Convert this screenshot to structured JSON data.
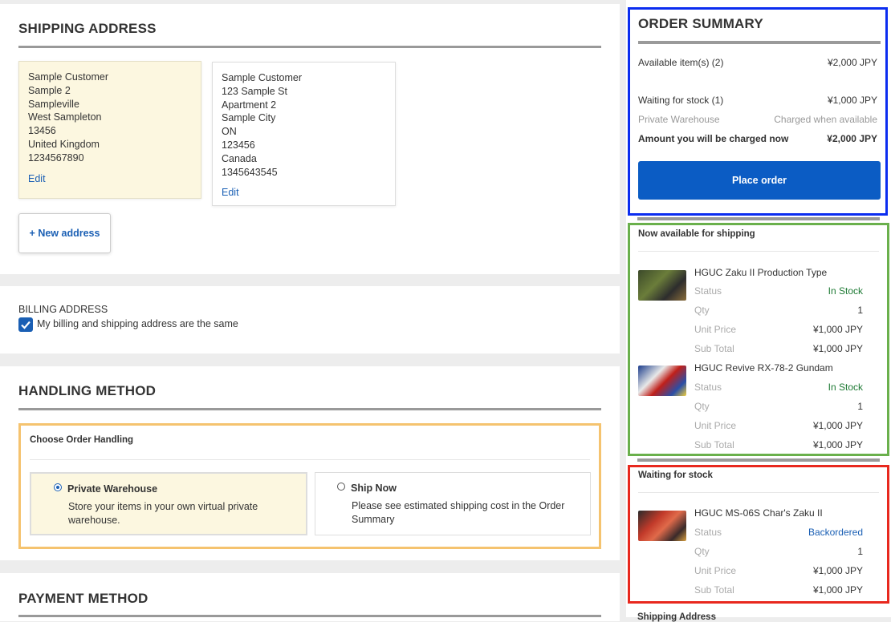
{
  "shipping": {
    "title": "SHIPPING ADDRESS",
    "addresses": [
      {
        "lines": [
          "Sample Customer",
          "Sample 2",
          "Sampleville",
          "West Sampleton",
          "13456",
          "United Kingdom",
          "1234567890"
        ],
        "edit": "Edit",
        "selected": true
      },
      {
        "lines": [
          "Sample Customer",
          "123 Sample St",
          "Apartment 2",
          "Sample City",
          "ON",
          "123456",
          "Canada",
          "1345643545"
        ],
        "edit": "Edit",
        "selected": false
      }
    ],
    "new_address": "+ New address"
  },
  "billing": {
    "title": "BILLING ADDRESS",
    "same_label": "My billing and shipping address are the same",
    "checked": true
  },
  "handling": {
    "title": "HANDLING METHOD",
    "choose_label": "Choose Order Handling",
    "options": [
      {
        "title": "Private Warehouse",
        "desc": "Store your items in your own virtual private warehouse.",
        "selected": true
      },
      {
        "title": "Ship Now",
        "desc": "Please see estimated shipping cost in the Order Summary",
        "selected": false
      }
    ]
  },
  "payment": {
    "title": "PAYMENT METHOD"
  },
  "summary": {
    "title": "ORDER SUMMARY",
    "available_label": "Available item(s) (2)",
    "available_value": "¥2,000 JPY",
    "waiting_label": "Waiting for stock (1)",
    "waiting_value": "¥1,000 JPY",
    "warehouse_label": "Private Warehouse",
    "warehouse_value": "Charged when available",
    "charged_label": "Amount you will be charged now",
    "charged_value": "¥2,000 JPY",
    "place_order": "Place order"
  },
  "available_section": {
    "title": "Now available for shipping",
    "items": [
      {
        "name": "HGUC Zaku II Production Type",
        "status_label": "Status",
        "status": "In Stock",
        "qty_label": "Qty",
        "qty": "1",
        "unit_label": "Unit Price",
        "unit": "¥1,000 JPY",
        "sub_label": "Sub Total",
        "sub": "¥1,000 JPY"
      },
      {
        "name": "HGUC Revive RX-78-2 Gundam",
        "status_label": "Status",
        "status": "In Stock",
        "qty_label": "Qty",
        "qty": "1",
        "unit_label": "Unit Price",
        "unit": "¥1,000 JPY",
        "sub_label": "Sub Total",
        "sub": "¥1,000 JPY"
      }
    ]
  },
  "waiting_section": {
    "title": "Waiting for stock",
    "items": [
      {
        "name": "HGUC MS-06S Char's Zaku II",
        "status_label": "Status",
        "status": "Backordered",
        "qty_label": "Qty",
        "qty": "1",
        "unit_label": "Unit Price",
        "unit": "¥1,000 JPY",
        "sub_label": "Sub Total",
        "sub": "¥1,000 JPY"
      }
    ]
  },
  "cutoff_label": "Shipping Address",
  "colors": {
    "accent": "#1a5fb4",
    "in_stock": "#1e7a34",
    "backordered": "#1a5fb4",
    "summary_box": "#0b2df0",
    "available_box": "#6ab04c",
    "waiting_box": "#e8281e",
    "handling_box": "#f5c36f"
  }
}
